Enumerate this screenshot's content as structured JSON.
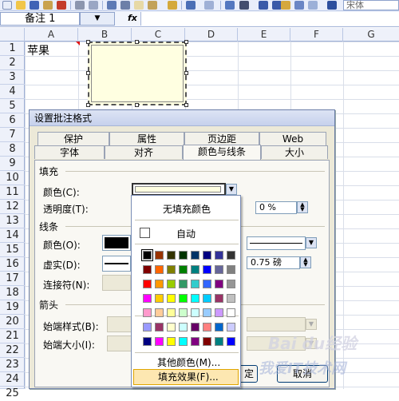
{
  "toolbar": {
    "font_box": "宋体"
  },
  "name_box": {
    "value": "备注 1",
    "dropdown": "▼",
    "fx_label": "fx"
  },
  "sheet": {
    "columns": [
      "A",
      "B",
      "C",
      "D",
      "E",
      "F",
      "G"
    ],
    "rows": [
      "1",
      "2",
      "3",
      "4",
      "5",
      "6",
      "7",
      "8",
      "9",
      "10",
      "11",
      "12",
      "13",
      "14",
      "15",
      "16",
      "17",
      "18",
      "19",
      "20",
      "21",
      "22",
      "23",
      "24",
      "25"
    ],
    "cell_a1": "苹果"
  },
  "dialog": {
    "title": "设置批注格式",
    "tabs_back": [
      "保护",
      "属性",
      "页边距",
      "Web"
    ],
    "tabs_front": [
      "字体",
      "对齐",
      "颜色与线条",
      "大小"
    ],
    "active_tab": "颜色与线条",
    "fill_section": "填充",
    "color_label": "颜色(C):",
    "transparency_label": "透明度(T):",
    "transparency_value": "0 %",
    "line_section": "线条",
    "line_color_label": "颜色(O):",
    "dashed_label": "虚实(D):",
    "weight_value": "0.75 磅",
    "connector_label": "连接符(N):",
    "arrow_section": "箭头",
    "begin_style_label": "始端样式(B):",
    "begin_size_label": "始端大小(I):",
    "ok_partial": "定",
    "cancel": "取消"
  },
  "color_panel": {
    "no_fill": "无填充颜色",
    "auto": "自动",
    "more_colors": "其他颜色(M)...",
    "fill_effects": "填充效果(F)...",
    "colors": {
      "row1": [
        "#000000",
        "#993300",
        "#333300",
        "#003300",
        "#003366",
        "#000080",
        "#333399",
        "#333333"
      ],
      "row2": [
        "#800000",
        "#FF6600",
        "#808000",
        "#008000",
        "#008080",
        "#0000FF",
        "#666699",
        "#808080"
      ],
      "row3": [
        "#FF0000",
        "#FF9900",
        "#99CC00",
        "#339966",
        "#33CCCC",
        "#3366FF",
        "#800080",
        "#969696"
      ],
      "row4": [
        "#FF00FF",
        "#FFCC00",
        "#FFFF00",
        "#00FF00",
        "#00FFFF",
        "#00CCFF",
        "#993366",
        "#C0C0C0"
      ],
      "row5": [
        "#FF99CC",
        "#FFCC99",
        "#FFFF99",
        "#CCFFCC",
        "#CCFFFF",
        "#99CCFF",
        "#CC99FF",
        "#FFFFFF"
      ],
      "row6": [
        "#9999FF",
        "#993366",
        "#FFFFCC",
        "#CCFFFF",
        "#660066",
        "#FF8080",
        "#0066CC",
        "#CCCCFF"
      ],
      "row7": [
        "#000080",
        "#FF00FF",
        "#FFFF00",
        "#00FFFF",
        "#800080",
        "#800000",
        "#008080",
        "#0000FF"
      ]
    }
  },
  "watermark": {
    "line1": "Bai du经验",
    "line2": "我爱IT技术网"
  }
}
